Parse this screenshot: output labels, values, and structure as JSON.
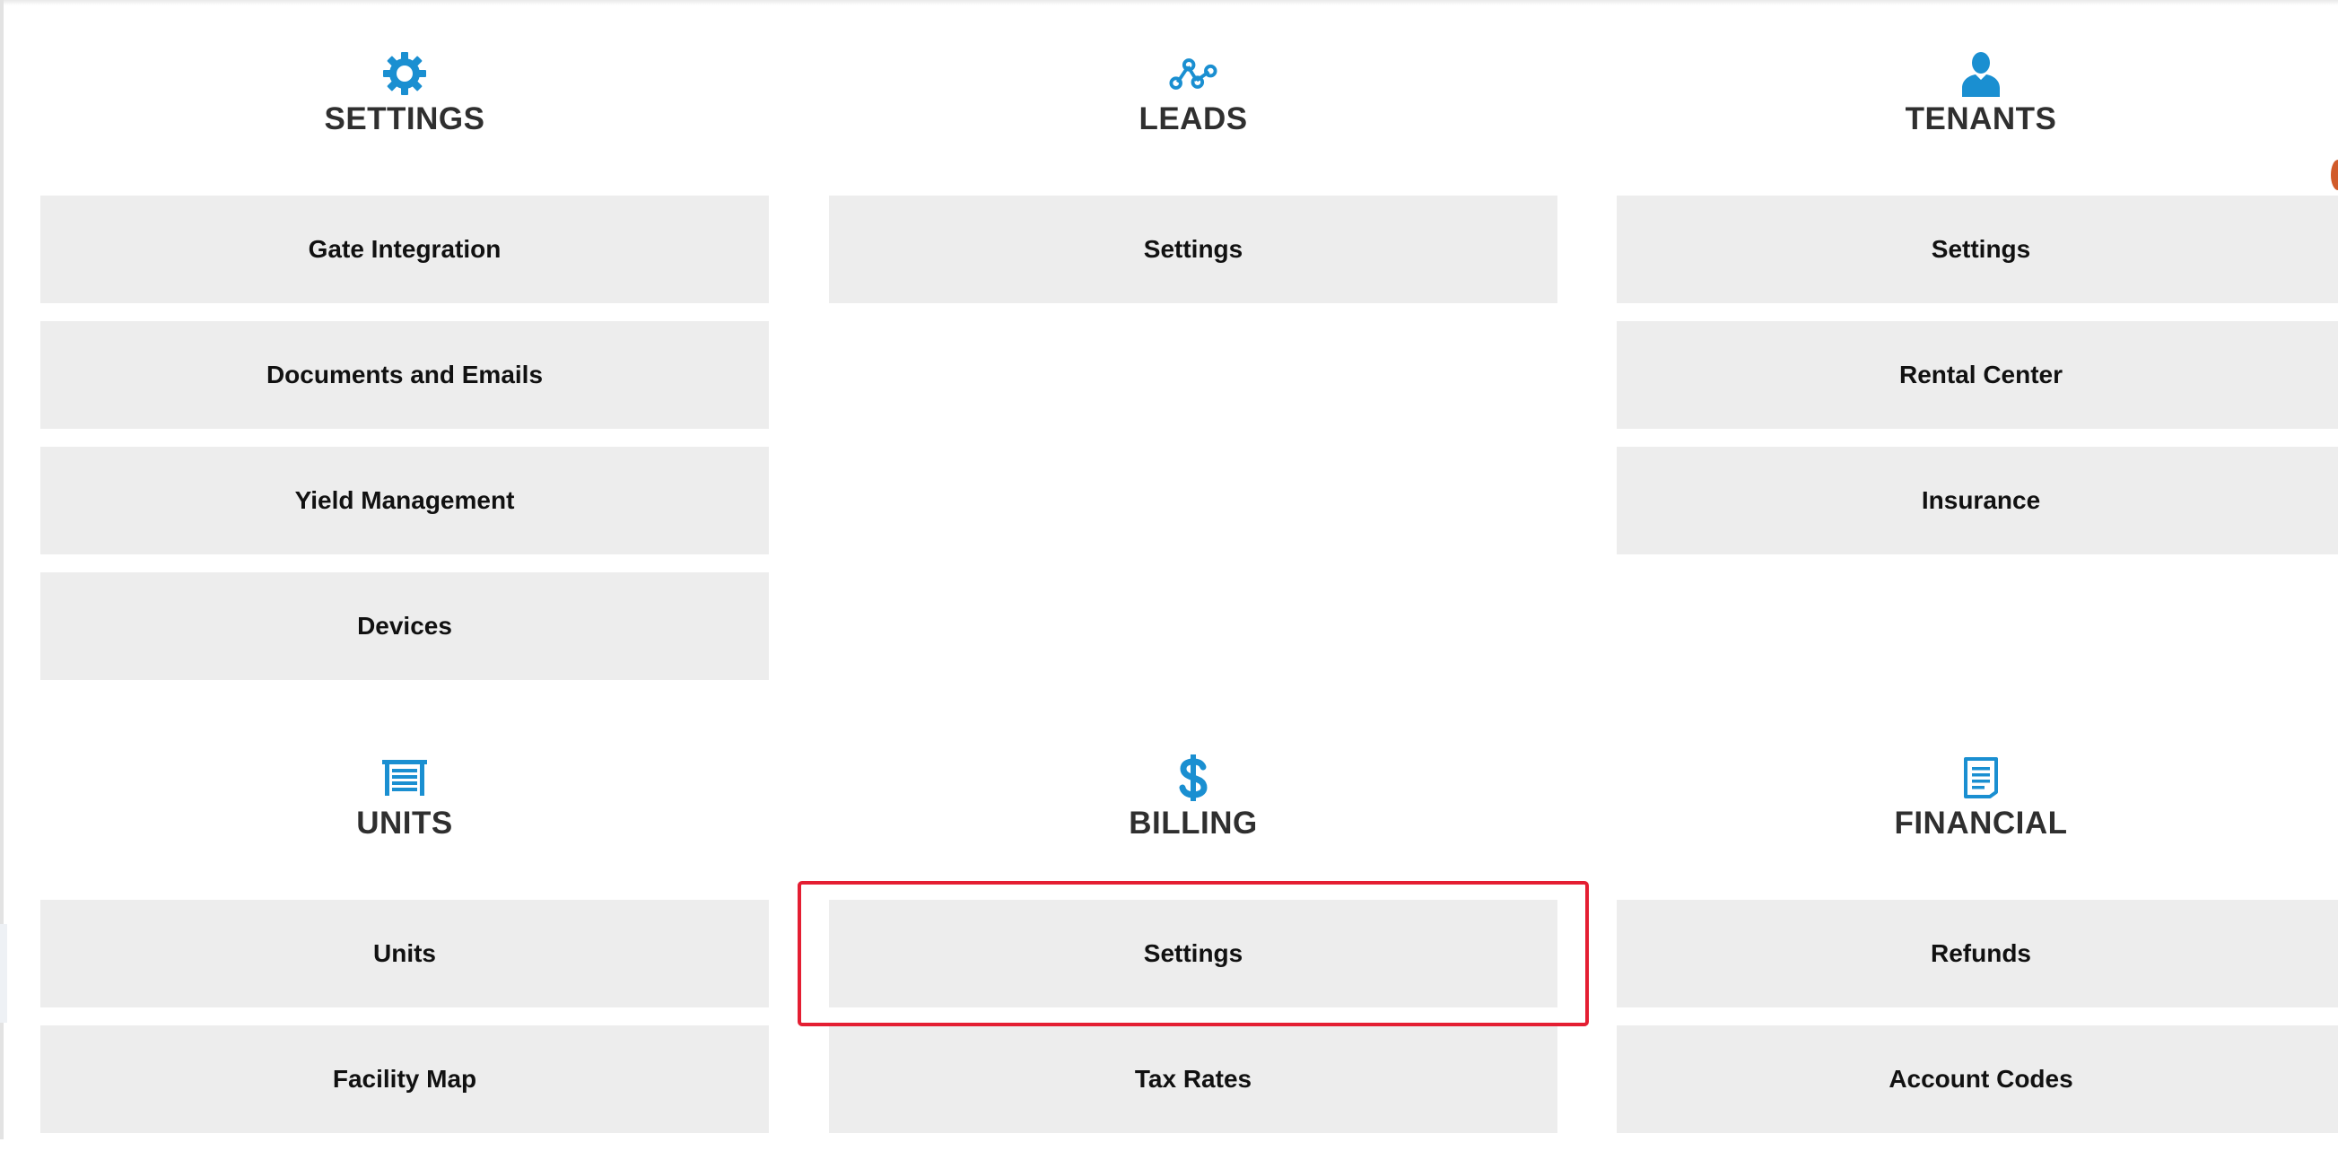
{
  "sections": [
    {
      "title": "SETTINGS",
      "icon": "gear-icon",
      "items": [
        {
          "label": "Gate Integration"
        },
        {
          "label": "Documents and Emails"
        },
        {
          "label": "Yield Management"
        },
        {
          "label": "Devices"
        }
      ]
    },
    {
      "title": "LEADS",
      "icon": "leads-nodes-icon",
      "items": [
        {
          "label": "Settings"
        }
      ]
    },
    {
      "title": "TENANTS",
      "icon": "person-icon",
      "items": [
        {
          "label": "Settings"
        },
        {
          "label": "Rental Center"
        },
        {
          "label": "Insurance"
        }
      ]
    },
    {
      "title": "UNITS",
      "icon": "storage-unit-icon",
      "items": [
        {
          "label": "Units"
        },
        {
          "label": "Facility Map"
        }
      ]
    },
    {
      "title": "BILLING",
      "icon": "dollar-icon",
      "items": [
        {
          "label": "Settings"
        },
        {
          "label": "Tax Rates"
        }
      ]
    },
    {
      "title": "FINANCIAL",
      "icon": "document-icon",
      "items": [
        {
          "label": "Refunds"
        },
        {
          "label": "Account Codes"
        }
      ]
    }
  ],
  "colors": {
    "accent": "#1a8fd1",
    "highlight": "#e41e32",
    "button_bg": "#ededed"
  }
}
